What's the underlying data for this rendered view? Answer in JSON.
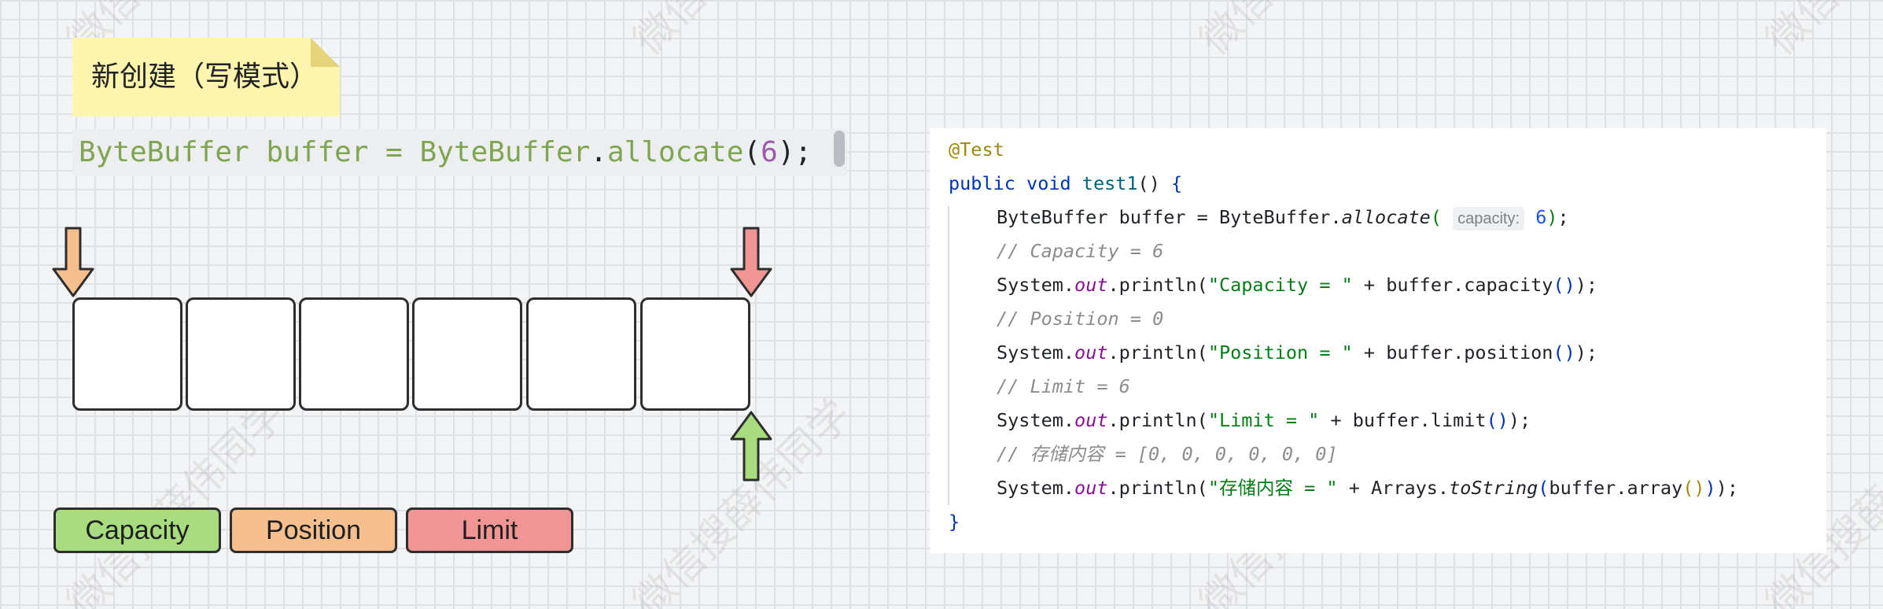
{
  "note": {
    "label": "新创建（写模式）"
  },
  "statement": {
    "type_name": "ByteBuffer",
    "var_name": "buffer",
    "assign": "=",
    "class_name": "ByteBuffer",
    "dot": ".",
    "method": "allocate",
    "open": "(",
    "arg": "6",
    "close": ");"
  },
  "buffer_cells": 6,
  "legend": {
    "capacity": {
      "label": "Capacity",
      "color": "#a8dc7f"
    },
    "position": {
      "label": "Position",
      "color": "#f5c08d"
    },
    "limit": {
      "label": "Limit",
      "color": "#f19594"
    }
  },
  "code": {
    "annotation": "@Test",
    "sig": {
      "kw1": "public",
      "kw2": "void",
      "name": "test1",
      "parens": "()",
      "brace": "{"
    },
    "alloc": {
      "prefix": "ByteBuffer buffer = ByteBuffer.",
      "method": "allocate",
      "open": "(",
      "hint": "capacity:",
      "num": "6",
      "close": ")",
      "semi": ";"
    },
    "comment1": "// Capacity = 6",
    "print1": {
      "prefix": "System.",
      "field": "out",
      "mid": ".println(",
      "str": "\"Capacity = \"",
      "plus": " + buffer.capacity",
      "inner": "()",
      "close": ")",
      "semi": ";"
    },
    "comment2": "// Position = 0",
    "print2": {
      "prefix": "System.",
      "field": "out",
      "mid": ".println(",
      "str": "\"Position = \"",
      "plus": " + buffer.position",
      "inner": "()",
      "close": ")",
      "semi": ";"
    },
    "comment3": "// Limit = 6",
    "print3": {
      "prefix": "System.",
      "field": "out",
      "mid": ".println(",
      "str": "\"Limit = \"",
      "plus": " + buffer.limit",
      "inner": "()",
      "close": ")",
      "semi": ";"
    },
    "comment4": "// 存储内容 = [0, 0, 0, 0, 0, 0]",
    "print4": {
      "prefix": "System.",
      "field": "out",
      "mid": ".println(",
      "str": "\"存储内容 = \"",
      "plus": " + Arrays.",
      "method": "toString",
      "open": "(",
      "call": "buffer.array",
      "inner": "()",
      "close1": ")",
      "close2": ")",
      "semi": ";"
    },
    "end_brace": "}"
  },
  "watermark": "微信搜薛伟同学"
}
